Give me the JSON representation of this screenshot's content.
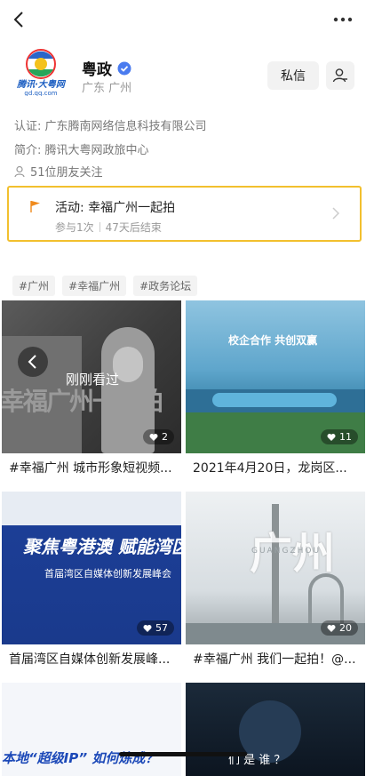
{
  "header": {
    "back_icon": "back-chevron-icon",
    "more_icon": "more-dots-icon"
  },
  "profile": {
    "name": "粤政",
    "location": "广东 广州",
    "avatar_text": "腾讯·大粤网",
    "avatar_subtext": "gd.qq.com",
    "verified_color": "#4a7bef",
    "message_label": "私信",
    "cert": "认证: 广东腾南网络信息科技有限公司",
    "intro": "简介: 腾讯大粤网政旅中心",
    "friends": "51位朋友关注"
  },
  "activity": {
    "title": "活动: 幸福广州一起拍",
    "joined": "参与1次",
    "remaining": "47天后结束",
    "border_color": "#f2c02e"
  },
  "tags": [
    "#广州",
    "#幸福广州",
    "#政务论坛"
  ],
  "cards": [
    {
      "caption": "#幸福广州 城市形象短视频...",
      "likes": "2",
      "overlay": "刚刚看过",
      "wall_text": "幸福广州一起拍"
    },
    {
      "caption": "2021年4月20日，龙岗区...",
      "likes": "11",
      "banner": "校企合作 共创双赢"
    },
    {
      "caption": "首届湾区自媒体创新发展峰...",
      "likes": "57",
      "banner_main": "聚焦粤港澳 赋能湾区新时",
      "banner_sub": "首届湾区自媒体创新发展峰会"
    },
    {
      "caption": "#幸福广州 我们一起拍！@...",
      "likes": "20",
      "calligraphy": "广州",
      "city_en": "GUANGZHOU"
    },
    {
      "caption_partial": "本地“超级IP” 如何炼成？"
    },
    {
      "caption_partial": "们 是 谁 ？"
    }
  ]
}
